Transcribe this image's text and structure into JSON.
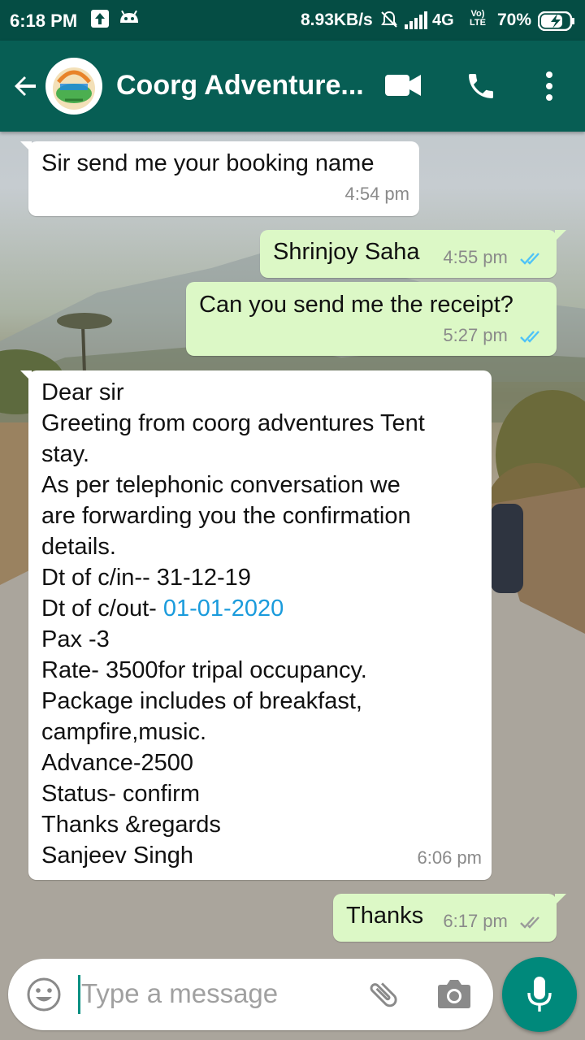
{
  "status_bar": {
    "time": "6:18 PM",
    "speed": "8.93KB/s",
    "network": "4G",
    "volte_top": "Vo)",
    "volte_bottom": "LTE",
    "battery": "70%"
  },
  "header": {
    "title": "Coorg Adventure..."
  },
  "messages": [
    {
      "direction": "in",
      "text": "Sir send me your booking name",
      "time": "4:54 pm"
    },
    {
      "direction": "out",
      "text": "Shrinjoy Saha",
      "time": "4:55 pm",
      "status": "read"
    },
    {
      "direction": "out",
      "text": "Can you send me the receipt?",
      "time": "5:27 pm",
      "status": "read"
    },
    {
      "direction": "in",
      "lines": [
        "Dear sir",
        "Greeting from coorg adventures Tent",
        "stay.",
        "As per telephonic conversation we",
        "are forwarding you the confirmation",
        "details.",
        "Dt of c/in-- 31-12-19"
      ],
      "line_checkout_prefix": "Dt of c/out- ",
      "line_checkout_date": "01-01-2020",
      "lines_after": [
        "Pax -3",
        "Rate- 3500for tripal occupancy.",
        "Package includes of breakfast,",
        "campfire,music.",
        "Advance-2500",
        "Status- confirm",
        "Thanks &regards",
        "Sanjeev Singh"
      ],
      "time": "6:06 pm"
    },
    {
      "direction": "out",
      "text": "Thanks",
      "time": "6:17 pm",
      "status": "delivered"
    }
  ],
  "composer": {
    "placeholder": "Type a message"
  },
  "colors": {
    "header": "#075e54",
    "status_bar": "#054d44",
    "outgoing_bubble": "#dcf8c6",
    "incoming_bubble": "#ffffff",
    "read_ticks": "#4fc3f7",
    "link": "#1a9bdc",
    "mic_button": "#00897b"
  },
  "icons": [
    "back-arrow-icon",
    "video-call-icon",
    "phone-icon",
    "more-vert-icon",
    "emoji-icon",
    "attach-icon",
    "camera-icon",
    "mic-icon"
  ]
}
